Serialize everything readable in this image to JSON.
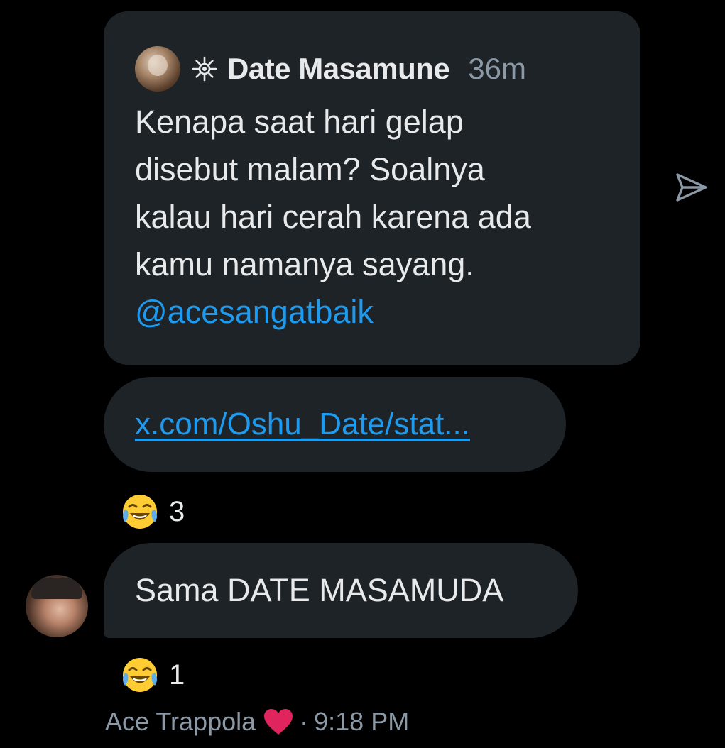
{
  "quote": {
    "author_name": "Date Masamune",
    "time_ago": "36m",
    "text_lines": [
      "Kenapa saat hari gelap",
      "disebut malam? Soalnya",
      "kalau hari cerah karena ada",
      "kamu namanya sayang."
    ],
    "mention": "@acesangatbaik"
  },
  "link": {
    "text": "x.com/Oshu_Date/stat..."
  },
  "reactions": [
    {
      "emoji": "😂",
      "count": "3"
    },
    {
      "emoji": "😂",
      "count": "1"
    }
  ],
  "reply": {
    "text": "Sama DATE MASAMUDA"
  },
  "footer": {
    "sender": "Ace Trappola",
    "separator": "·",
    "time": "9:18 PM"
  },
  "icons": {
    "emblem": "sun-emblem-icon",
    "share": "send-icon",
    "heart": "heart-icon",
    "reaction": "tears-of-joy-emoji-icon"
  },
  "colors": {
    "background": "#000000",
    "bubble": "#1e2328",
    "text": "#e7e9ea",
    "muted": "#8b98a5",
    "link": "#1d9bf0",
    "heart": "#e0245e"
  }
}
